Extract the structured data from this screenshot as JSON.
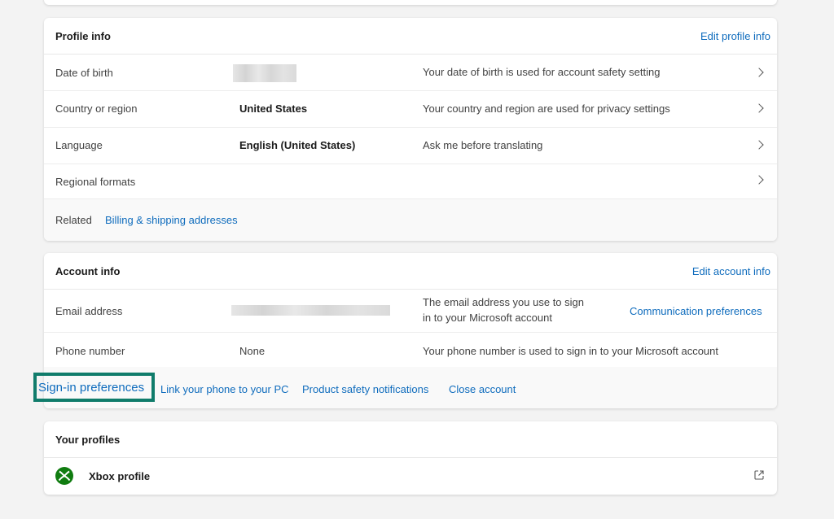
{
  "profile_info": {
    "title": "Profile info",
    "edit_link": "Edit profile info",
    "rows": [
      {
        "label": "Date of birth",
        "value": "",
        "desc": "Your date of birth is used for account safety setting"
      },
      {
        "label": "Country or region",
        "value": "United States",
        "desc": "Your country and region are used for privacy settings"
      },
      {
        "label": "Language",
        "value": "English (United States)",
        "desc": "Ask me before translating"
      },
      {
        "label": "Regional formats",
        "value": "",
        "desc": ""
      }
    ],
    "related_label": "Related",
    "related_link": "Billing & shipping addresses"
  },
  "account_info": {
    "title": "Account info",
    "edit_link": "Edit account info",
    "email_label": "Email address",
    "email_desc_line1": "The email address you use to sign",
    "email_desc_line2": "in to your Microsoft account",
    "email_link": "Communication preferences",
    "phone_label": "Phone number",
    "phone_value": "None",
    "phone_desc": "Your phone number is used to sign in to your Microsoft account",
    "footer_links": {
      "sign_in": "Sign-in preferences",
      "link_phone": "Link your phone to your PC",
      "safety": "Product safety notifications",
      "close": "Close account"
    }
  },
  "your_profiles": {
    "title": "Your profiles",
    "xbox_label": "Xbox profile",
    "icons": [
      "xbox-icon",
      "external-link-icon"
    ]
  },
  "colors": {
    "link": "#0f6cbd",
    "highlight": "#107c6b",
    "xbox_green": "#107c10"
  }
}
